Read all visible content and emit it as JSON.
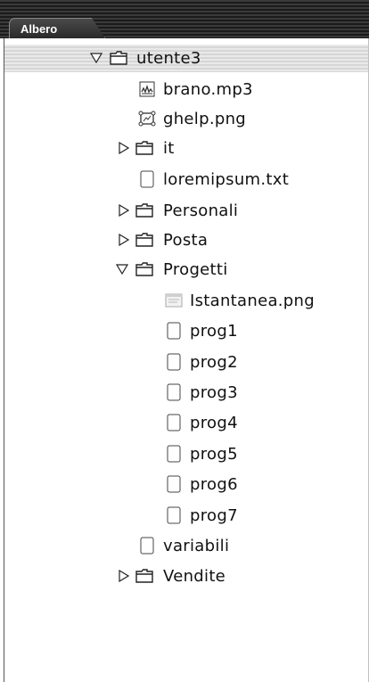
{
  "tab": {
    "label": "Albero"
  },
  "tree": {
    "root": "utente3",
    "items": [
      {
        "label": "brano.mp3"
      },
      {
        "label": "ghelp.png"
      },
      {
        "label": "it"
      },
      {
        "label": "loremipsum.txt"
      },
      {
        "label": "Personali"
      },
      {
        "label": "Posta"
      },
      {
        "label": "Progetti"
      },
      {
        "label": "Istantanea.png"
      },
      {
        "label": "prog1"
      },
      {
        "label": "prog2"
      },
      {
        "label": "prog3"
      },
      {
        "label": "prog4"
      },
      {
        "label": "prog5"
      },
      {
        "label": "prog6"
      },
      {
        "label": "prog7"
      },
      {
        "label": "variabili"
      },
      {
        "label": "Vendite"
      }
    ]
  }
}
